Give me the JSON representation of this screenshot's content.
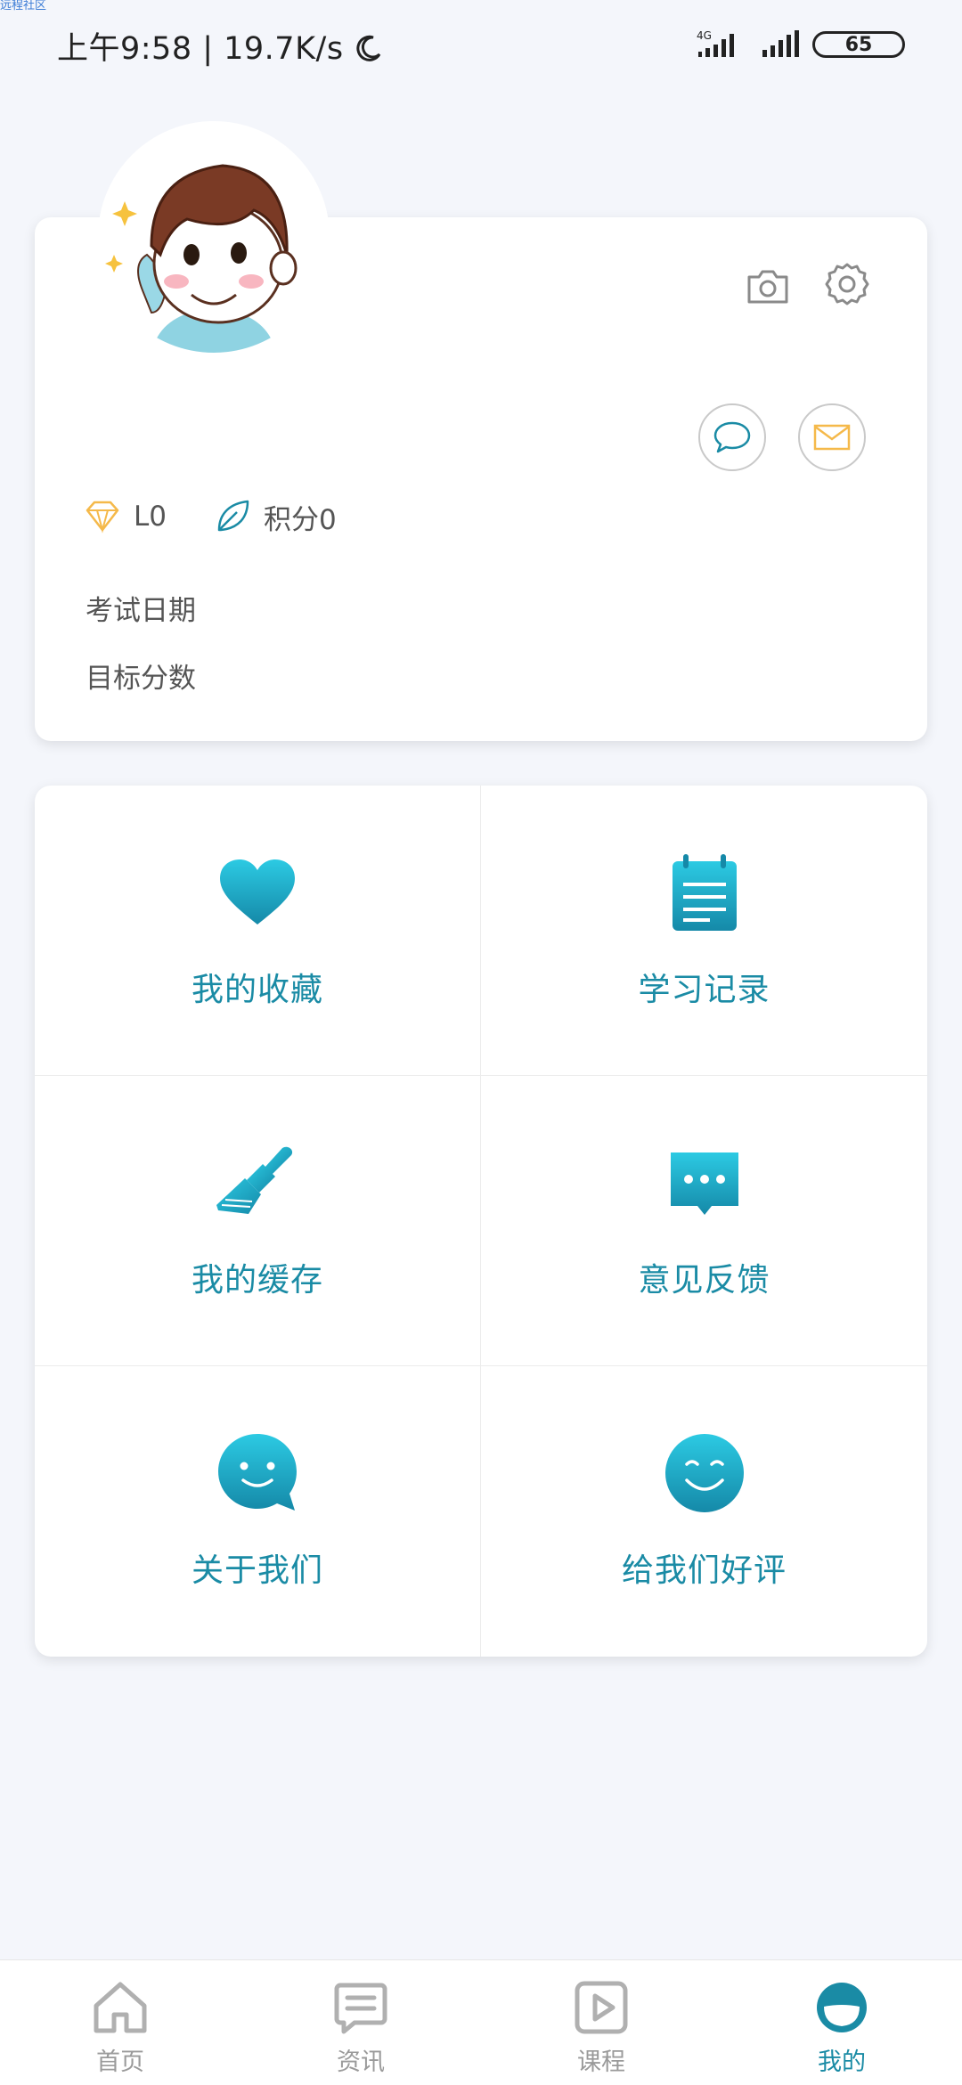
{
  "watermark": "远程社区",
  "status_bar": {
    "time_speed": "上午9:58 | 19.7K/s",
    "network": "4G",
    "battery": "65"
  },
  "profile": {
    "level": "L0",
    "points": "积分0",
    "exam_date_label": "考试日期",
    "target_score_label": "目标分数"
  },
  "menu": {
    "items": [
      {
        "label": "我的收藏",
        "icon": "heart-icon"
      },
      {
        "label": "学习记录",
        "icon": "notepad-icon"
      },
      {
        "label": "我的缓存",
        "icon": "brush-icon"
      },
      {
        "label": "意见反馈",
        "icon": "message-bubble-icon"
      },
      {
        "label": "关于我们",
        "icon": "smile-chat-icon"
      },
      {
        "label": "给我们好评",
        "icon": "smiley-icon"
      }
    ]
  },
  "tabbar": {
    "tabs": [
      {
        "label": "首页",
        "icon": "home-icon"
      },
      {
        "label": "资讯",
        "icon": "news-icon"
      },
      {
        "label": "课程",
        "icon": "play-icon"
      },
      {
        "label": "我的",
        "icon": "profile-icon",
        "active": true
      }
    ]
  },
  "colors": {
    "accent": "#1a8ba5",
    "accent_light": "#29c1dc",
    "gold": "#f5b94a",
    "background": "#f4f6fb"
  }
}
